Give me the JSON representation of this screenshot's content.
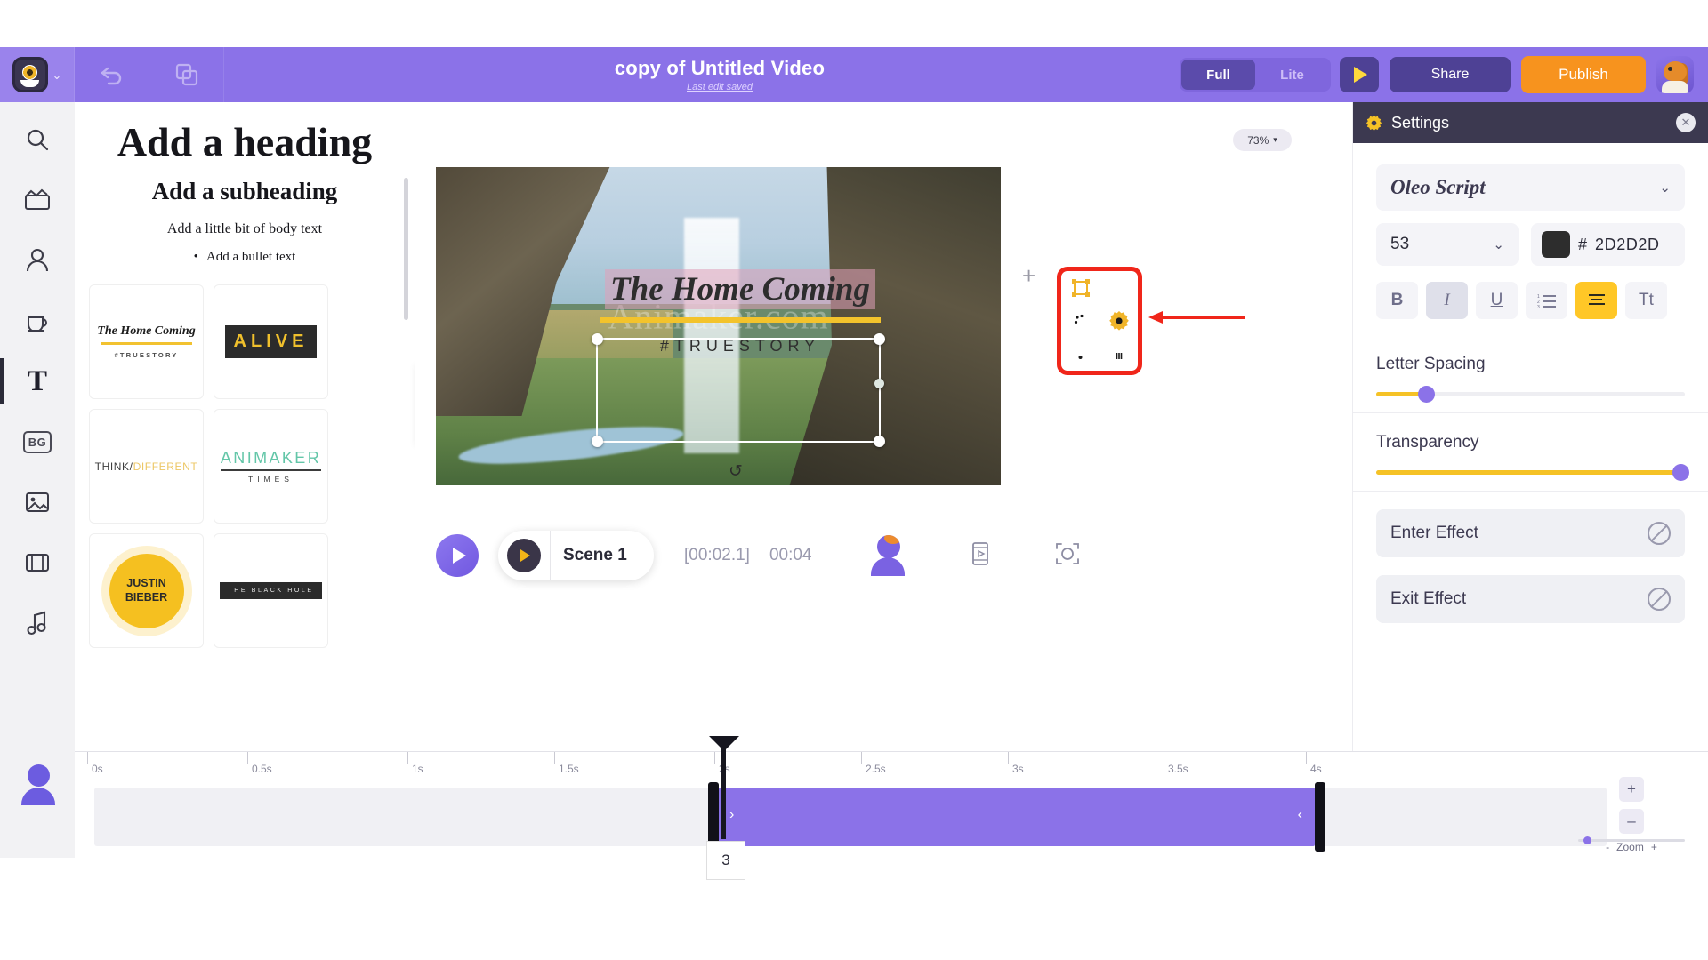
{
  "topbar": {
    "brand_icon": "animaker-mascot-icon",
    "brand_caret": "⌄",
    "undo_icon": "undo-icon",
    "copy_icon": "duplicate-icon",
    "doc_title": "copy of Untitled Video",
    "doc_subtitle": "Last edit saved",
    "mode_full": "Full",
    "mode_lite": "Lite",
    "preview_icon": "play-icon",
    "share_label": "Share",
    "publish_label": "Publish",
    "avatar_icon": "user-avatar-icon",
    "bg_color": "#8b72e8",
    "publish_color": "#f7931e"
  },
  "rail": {
    "items": [
      {
        "name": "search",
        "glyph": "search-icon"
      },
      {
        "name": "video",
        "glyph": "clapperboard-icon"
      },
      {
        "name": "character",
        "glyph": "character-icon"
      },
      {
        "name": "props",
        "glyph": "props-icon"
      },
      {
        "name": "text",
        "glyph": "T"
      },
      {
        "name": "background",
        "glyph": "BG"
      },
      {
        "name": "image",
        "glyph": "image-icon"
      },
      {
        "name": "video-library",
        "glyph": "film-icon"
      },
      {
        "name": "music",
        "glyph": "music-note-icon"
      }
    ],
    "active": "text"
  },
  "text_panel": {
    "heading": "Add a heading",
    "subheading": "Add a subheading",
    "body": "Add a little bit of body text",
    "bullet": "Add a bullet text",
    "templates": [
      {
        "id": "home-coming",
        "title": "The Home Coming",
        "tag": "#TRUESTORY"
      },
      {
        "id": "alive",
        "title": "ALIVE"
      },
      {
        "id": "think-different",
        "part1": "THINK/",
        "part2": "DIFFERENT"
      },
      {
        "id": "animaker-times",
        "title": "ANIMAKER",
        "sub": "TIMES"
      },
      {
        "id": "justin-bieber",
        "line1": "JUSTIN",
        "line2": "BIEBER"
      },
      {
        "id": "black-hole",
        "title": "THE BLACK HOLE"
      }
    ],
    "collapse_icon": "chevron-left-icon"
  },
  "stage": {
    "zoom_level": "73%",
    "zoom_caret": "▾",
    "canvas_text_main": "The Home Coming",
    "canvas_text_tag": "#TRUESTORY",
    "watermark": "Animaker.com",
    "rotate_icon": "rotate-icon",
    "add_scene_icon": "plus-icon",
    "float_tools": [
      {
        "name": "crop-icon"
      },
      {
        "name": "path-animation-icon"
      },
      {
        "name": "palette-icon"
      },
      {
        "name": "settings-gear-icon"
      },
      {
        "name": "unlock-icon"
      },
      {
        "name": "trash-icon"
      }
    ],
    "highlight_color": "#f0261a",
    "arrow_icon": "red-arrow-pointer"
  },
  "playbar": {
    "play_icon": "play-icon",
    "scene_play_icon": "play-icon",
    "scene_label": "Scene 1",
    "current_time": "[00:02.1]",
    "total_time": "00:04",
    "character_icon": "character-icon",
    "scene_icon": "scene-strip-icon",
    "focus_icon": "focus-frame-icon"
  },
  "timeline": {
    "ticks": [
      "0s",
      "0.5s",
      "1s",
      "1.5s",
      "2s",
      "2.5s",
      "3s",
      "3.5s",
      "4s"
    ],
    "frame_label": "3",
    "clip_color": "#8b72e8",
    "clip_chevron_left": "›",
    "clip_chevron_right": "‹",
    "zoom_in": "+",
    "zoom_out": "–",
    "zoom_label": "Zoom",
    "zoom_minus": "-",
    "zoom_plus": "+"
  },
  "settings": {
    "header_title": "Settings",
    "gear_icon": "gear-icon",
    "close_icon": "close-icon",
    "font_family": "Oleo Script",
    "font_size": "53",
    "hash": "#",
    "color_hex": "2D2D2D",
    "color_value": "#2d2d2d",
    "format_buttons": [
      {
        "name": "bold",
        "glyph": "B",
        "state": "off"
      },
      {
        "name": "italic",
        "glyph": "I",
        "state": "selected"
      },
      {
        "name": "underline",
        "glyph": "U",
        "state": "off"
      },
      {
        "name": "list",
        "glyph": "list-icon",
        "state": "off"
      },
      {
        "name": "align",
        "glyph": "align-center-icon",
        "state": "active"
      },
      {
        "name": "text-case",
        "glyph": "Tt",
        "state": "off"
      }
    ],
    "letter_spacing_label": "Letter Spacing",
    "letter_spacing_pct": 16,
    "transparency_label": "Transparency",
    "transparency_pct": 100,
    "enter_effect_label": "Enter Effect",
    "exit_effect_label": "Exit Effect",
    "effect_disabled_icon": "no-effect-icon",
    "accent_yellow": "#f5c226",
    "knob_purple": "#8b72e8"
  }
}
